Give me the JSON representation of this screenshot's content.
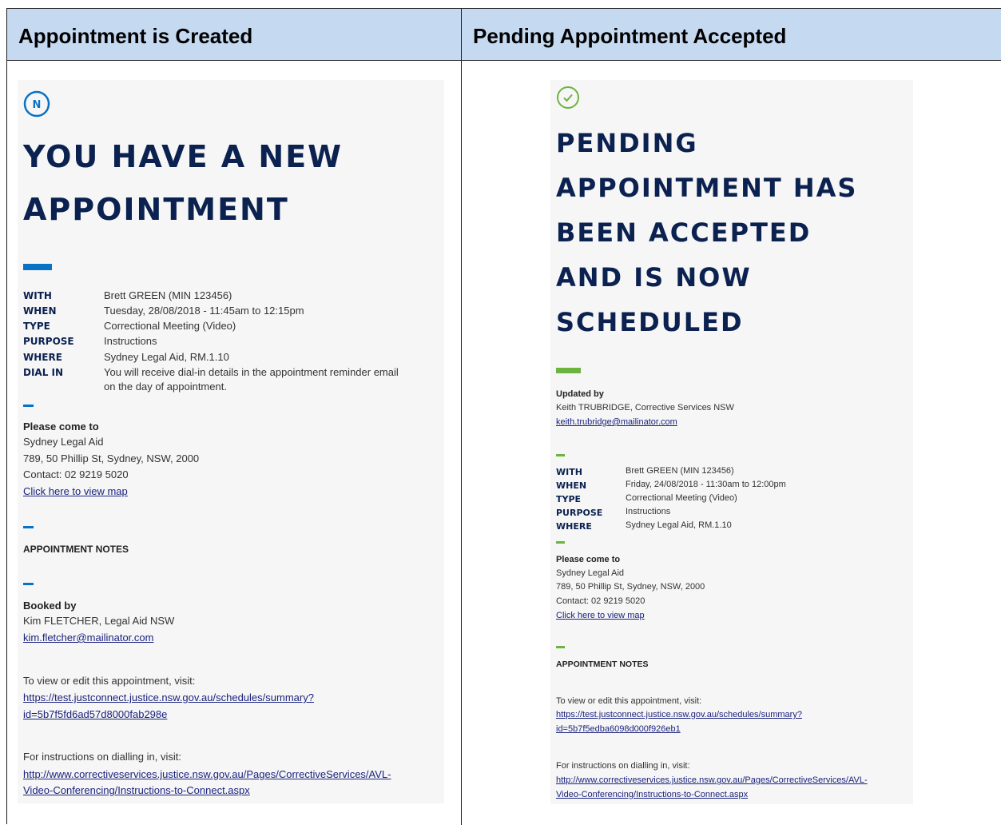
{
  "headers": {
    "left": "Appointment is Created",
    "right": "Pending Appointment Accepted"
  },
  "colors": {
    "header_bg": "#c5d9f1",
    "navy": "#0b2150",
    "blue_accent": "#0a72c4",
    "green_accent": "#6cb33f"
  },
  "left_email": {
    "icon_letter": "N",
    "title_lines": [
      "YOU HAVE A NEW",
      "APPOINTMENT"
    ],
    "details": [
      {
        "label": "WITH",
        "value": "Brett GREEN (MIN 123456)"
      },
      {
        "label": "WHEN",
        "value": "Tuesday, 28/08/2018 - 11:45am to 12:15pm"
      },
      {
        "label": "TYPE",
        "value": "Correctional Meeting (Video)"
      },
      {
        "label": "PURPOSE",
        "value": "Instructions"
      },
      {
        "label": "WHERE",
        "value": "Sydney Legal Aid, RM.1.10"
      },
      {
        "label": "DIAL IN",
        "value": "You will receive dial-in details in the appointment reminder email"
      }
    ],
    "dial_in_cont": "on the day of appointment.",
    "come_heading": "Please come to",
    "come_lines": [
      "Sydney Legal Aid",
      "789, 50 Phillip St, Sydney, NSW, 2000",
      "Contact: 02 9219 5020"
    ],
    "map_link": "Click here to view map",
    "notes_heading": "APPOINTMENT NOTES",
    "booked_heading": "Booked by",
    "booked_name": "Kim FLETCHER, Legal Aid NSW",
    "booked_email": "kim.fletcher@mailinator.com",
    "view_text": "To view or edit this appointment, visit:",
    "view_link_1": "https://test.justconnect.justice.nsw.gov.au/schedules/summary?",
    "view_link_2": "id=5b7f5fd6ad57d8000fab298e",
    "dial_text": "For instructions on dialling in, visit:",
    "dial_link_1": "http://www.correctiveservices.justice.nsw.gov.au/Pages/CorrectiveServices/AVL-",
    "dial_link_2": "Video-Conferencing/Instructions-to-Connect.aspx"
  },
  "right_email": {
    "title_lines": [
      "PENDING",
      "APPOINTMENT HAS",
      "BEEN ACCEPTED",
      "AND IS NOW",
      "SCHEDULED"
    ],
    "updated_heading": "Updated by",
    "updated_name": "Keith TRUBRIDGE, Corrective Services NSW",
    "updated_email": "keith.trubridge@mailinator.com",
    "details": [
      {
        "label": "WITH",
        "value": "Brett GREEN (MIN 123456)"
      },
      {
        "label": "WHEN",
        "value": "Friday, 24/08/2018 - 11:30am to 12:00pm"
      },
      {
        "label": "TYPE",
        "value": "Correctional Meeting (Video)"
      },
      {
        "label": "PURPOSE",
        "value": "Instructions"
      },
      {
        "label": "WHERE",
        "value": "Sydney Legal Aid, RM.1.10"
      }
    ],
    "come_heading": "Please come to",
    "come_lines": [
      "Sydney Legal Aid",
      "789, 50 Phillip St, Sydney, NSW, 2000",
      "Contact: 02 9219 5020"
    ],
    "map_link": "Click here to view map",
    "notes_heading": "APPOINTMENT NOTES",
    "view_text": "To view or edit this appointment, visit:",
    "view_link_1": "https://test.justconnect.justice.nsw.gov.au/schedules/summary?",
    "view_link_2": "id=5b7f5edba6098d000f926eb1",
    "dial_text": "For instructions on dialling in, visit:",
    "dial_link_1": "http://www.correctiveservices.justice.nsw.gov.au/Pages/CorrectiveServices/AVL-",
    "dial_link_2": "Video-Conferencing/Instructions-to-Connect.aspx"
  }
}
